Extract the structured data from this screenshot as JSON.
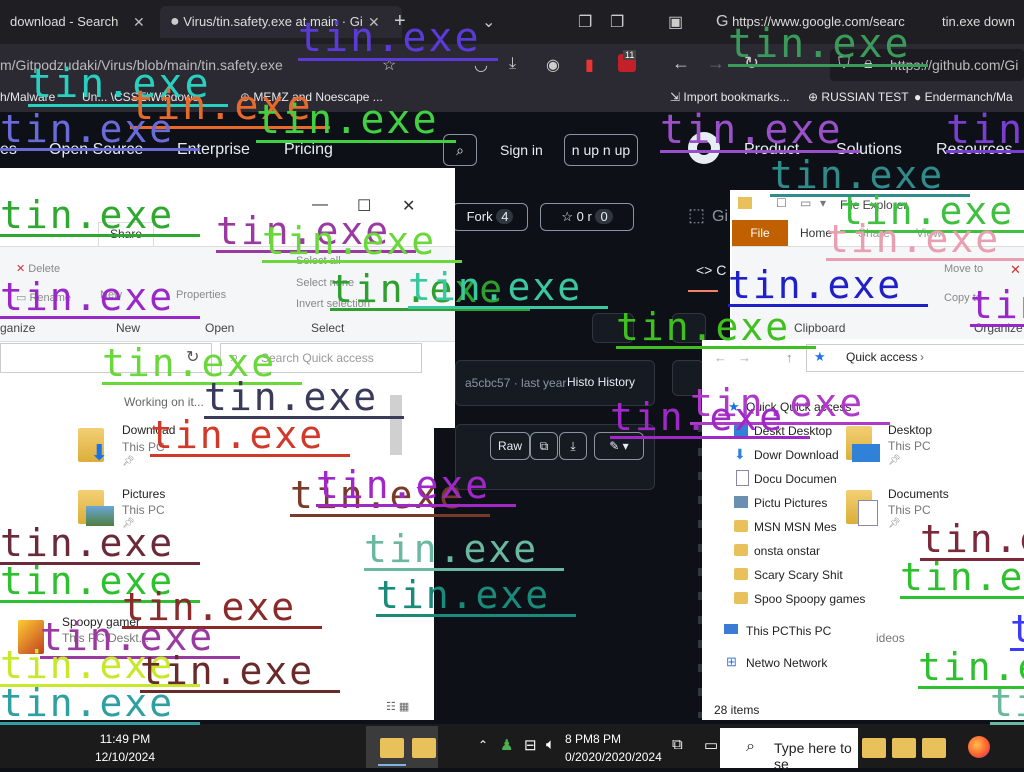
{
  "browser_left": {
    "tab1_title": "download - Search",
    "tab2_title": "Virus/tin.safety.exe at main · Gi",
    "url": "m/Gitpodzudaki/Virus/blob/main/tin.safety.exe",
    "bookmarks": [
      "h/Malware",
      "Un... \\CSSE\\Windows",
      "MEMZ and Noescape ..."
    ]
  },
  "browser_right": {
    "tab1_title": "https://www.google.com/searc",
    "tab2_title": "tin.exe down",
    "url": "https://github.com/Gi",
    "bookmarks": [
      "Import bookmarks...",
      "RUSSIAN TEST",
      "Endermanch/Ma"
    ],
    "badge": "11"
  },
  "github_left": {
    "nav": [
      "es",
      "Open Source",
      "Enterprise",
      "Pricing"
    ],
    "sign_in": "Sign in",
    "sign_up": "n up n up",
    "fork_label": "Fork",
    "fork_count": "4",
    "star_count": "0",
    "star_extra": "r",
    "commit_info": "a5cbc57 · last year",
    "history": "Histo History",
    "raw": "Raw"
  },
  "github_right": {
    "nav": [
      "Product",
      "Solutions",
      "Resources"
    ],
    "partial": "Gi",
    "code_partial": "C"
  },
  "explorer_left": {
    "ribbon_tab": "Share",
    "buttons": [
      "Delete",
      "Rename",
      "New",
      "Properties",
      "Select all",
      "Select none",
      "Invert selection"
    ],
    "groups": [
      "ganize",
      "New",
      "Open",
      "Select"
    ],
    "search_placeholder": "Search Quick access",
    "status": "Working on it...",
    "items": [
      {
        "name": "Download",
        "sub": "This PC"
      },
      {
        "name": "Pictures",
        "sub": "This PC"
      },
      {
        "name": "Spoopy gamer",
        "sub": "This PC\\Deskt..."
      }
    ]
  },
  "explorer_right": {
    "title": "File Explorer",
    "tabs": [
      "File",
      "Home",
      "Share",
      "View"
    ],
    "buttons": [
      "Move to",
      "Copy to"
    ],
    "groups": [
      "Clipboard",
      "Organize"
    ],
    "breadcrumb": "Quick access",
    "nav_items": [
      "Quick Quick access",
      "Deskt Desktop",
      "Dowr Download",
      "Docu Documen",
      "Pictu Pictures",
      "MSN MSN Mes",
      "onsta onstar",
      "Scary Scary Shit",
      "Spoo Spoopy games",
      "This PCThis PC",
      "Netwo Network"
    ],
    "files": [
      {
        "name": "Desktop",
        "sub": "This PC"
      },
      {
        "name": "Documents",
        "sub": "This PC"
      }
    ],
    "videos_partial": "ideos",
    "item_count": "28 items"
  },
  "overlay_text": "tin.exe",
  "taskbar": {
    "time": "11:49 PM",
    "date": "12/10/2024",
    "dup_time": "8 PM8 PM",
    "dup_date": "0/2020/2020/2024",
    "search_placeholder": "Type here to se"
  }
}
